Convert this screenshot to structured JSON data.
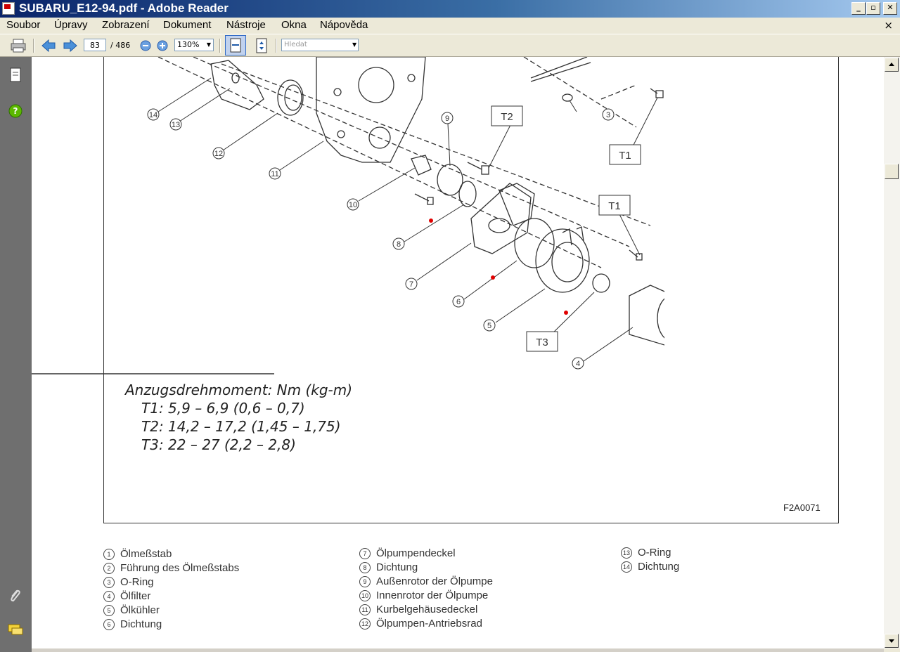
{
  "window": {
    "title": "SUBARU_E12-94.pdf - Adobe Reader",
    "minimize": "_",
    "restore": "▫",
    "close": "✕"
  },
  "menu": {
    "items": [
      "Soubor",
      "Úpravy",
      "Zobrazení",
      "Dokument",
      "Nástroje",
      "Okna",
      "Nápověda"
    ],
    "close": "×"
  },
  "toolbar": {
    "page_current": "83",
    "page_total": "/ 486",
    "zoom": "130%",
    "search_placeholder": "Hledat"
  },
  "document": {
    "torque": {
      "heading": "Anzugsdrehmoment: Nm (kg-m)",
      "t1": "T1:   5,9 – 6,9 (0,6 – 0,7)",
      "t2": "T2:   14,2 – 17,2 (1,45 – 1,75)",
      "t3": "T3:   22 – 27 (2,2 – 2,8)"
    },
    "figure_id": "F2A0071",
    "tboxes": {
      "t1": "T1",
      "t2": "T2",
      "t3": "T3"
    },
    "callout_numbers": [
      "14",
      "13",
      "12",
      "11",
      "10",
      "9",
      "8",
      "7",
      "6",
      "5",
      "4",
      "3"
    ],
    "legend": [
      {
        "num": "1",
        "label": "Ölmeßstab"
      },
      {
        "num": "2",
        "label": "Führung des Ölmeßstabs"
      },
      {
        "num": "3",
        "label": "O-Ring"
      },
      {
        "num": "4",
        "label": "Ölfilter"
      },
      {
        "num": "5",
        "label": "Ölkühler"
      },
      {
        "num": "6",
        "label": "Dichtung"
      },
      {
        "num": "7",
        "label": "Ölpumpendeckel"
      },
      {
        "num": "8",
        "label": "Dichtung"
      },
      {
        "num": "9",
        "label": "Außenrotor der Ölpumpe"
      },
      {
        "num": "10",
        "label": "Innenrotor der Ölpumpe"
      },
      {
        "num": "11",
        "label": "Kurbelgehäusedeckel"
      },
      {
        "num": "12",
        "label": "Ölpumpen-Antriebsrad"
      },
      {
        "num": "13",
        "label": "O-Ring"
      },
      {
        "num": "14",
        "label": "Dichtung"
      }
    ]
  },
  "colors": {
    "title_start": "#0a246a",
    "title_end": "#a6caf0",
    "nav_bg": "#6f6f6f",
    "marker_red": "#e00000"
  }
}
